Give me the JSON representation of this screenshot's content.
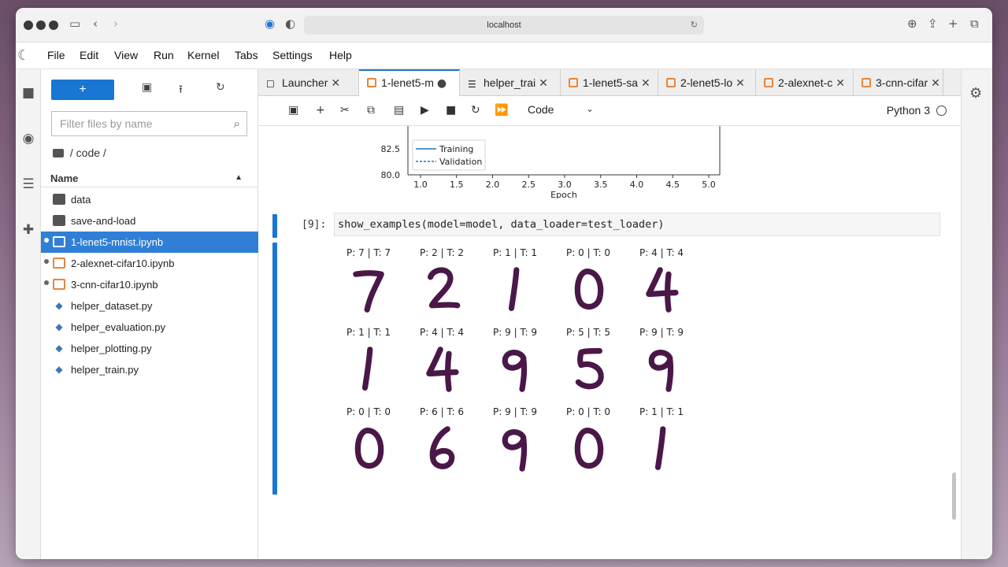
{
  "browser": {
    "url": "localhost"
  },
  "menu": [
    "File",
    "Edit",
    "View",
    "Run",
    "Kernel",
    "Tabs",
    "Settings",
    "Help"
  ],
  "filebrowser": {
    "new_label": "+",
    "filter_placeholder": "Filter files by name",
    "breadcrumb": "/ code /",
    "column_name": "Name",
    "items": [
      {
        "name": "data",
        "type": "folder",
        "running": false,
        "selected": false
      },
      {
        "name": "save-and-load",
        "type": "folder",
        "running": false,
        "selected": false
      },
      {
        "name": "1-lenet5-mnist.ipynb",
        "type": "notebook",
        "running": true,
        "selected": true
      },
      {
        "name": "2-alexnet-cifar10.ipynb",
        "type": "notebook",
        "running": true,
        "selected": false
      },
      {
        "name": "3-cnn-cifar10.ipynb",
        "type": "notebook",
        "running": true,
        "selected": false
      },
      {
        "name": "helper_dataset.py",
        "type": "python",
        "running": false,
        "selected": false
      },
      {
        "name": "helper_evaluation.py",
        "type": "python",
        "running": false,
        "selected": false
      },
      {
        "name": "helper_plotting.py",
        "type": "python",
        "running": false,
        "selected": false
      },
      {
        "name": "helper_train.py",
        "type": "python",
        "running": false,
        "selected": false
      }
    ]
  },
  "tabs": [
    {
      "label": "Launcher",
      "icon": "launcher-icon",
      "active": false
    },
    {
      "label": "1-lenet5-m",
      "icon": "notebook-icon",
      "active": true,
      "modified": true
    },
    {
      "label": "helper_trai",
      "icon": "text-file-icon",
      "active": false
    },
    {
      "label": "1-lenet5-sa",
      "icon": "notebook-icon",
      "active": false
    },
    {
      "label": "2-lenet5-lo",
      "icon": "notebook-icon",
      "active": false
    },
    {
      "label": "2-alexnet-c",
      "icon": "notebook-icon",
      "active": false
    },
    {
      "label": "3-cnn-cifar",
      "icon": "notebook-icon",
      "active": false
    }
  ],
  "toolbar": {
    "cell_type": "Code",
    "kernel": "Python 3"
  },
  "plot_tail": {
    "legend": [
      "Training",
      "Validation"
    ],
    "yticks": [
      "82.5",
      "80.0"
    ],
    "xticks": [
      "1.0",
      "1.5",
      "2.0",
      "2.5",
      "3.0",
      "3.5",
      "4.0",
      "4.5",
      "5.0"
    ],
    "xlabel": "Epoch"
  },
  "cell": {
    "prompt": "[9]:",
    "code": "show_examples(model=model, data_loader=test_loader)"
  },
  "examples": [
    {
      "label": "P: 7 | T: 7",
      "digit": 7
    },
    {
      "label": "P: 2 | T: 2",
      "digit": 2
    },
    {
      "label": "P: 1 | T: 1",
      "digit": 1
    },
    {
      "label": "P: 0 | T: 0",
      "digit": 0
    },
    {
      "label": "P: 4 | T: 4",
      "digit": 4
    },
    {
      "label": "P: 1 | T: 1",
      "digit": 1
    },
    {
      "label": "P: 4 | T: 4",
      "digit": 4
    },
    {
      "label": "P: 9 | T: 9",
      "digit": 9
    },
    {
      "label": "P: 5 | T: 5",
      "digit": 5
    },
    {
      "label": "P: 9 | T: 9",
      "digit": 9
    },
    {
      "label": "P: 0 | T: 0",
      "digit": 0
    },
    {
      "label": "P: 6 | T: 6",
      "digit": 6
    },
    {
      "label": "P: 9 | T: 9",
      "digit": 9
    },
    {
      "label": "P: 0 | T: 0",
      "digit": 0
    },
    {
      "label": "P: 1 | T: 1",
      "digit": 1
    }
  ]
}
